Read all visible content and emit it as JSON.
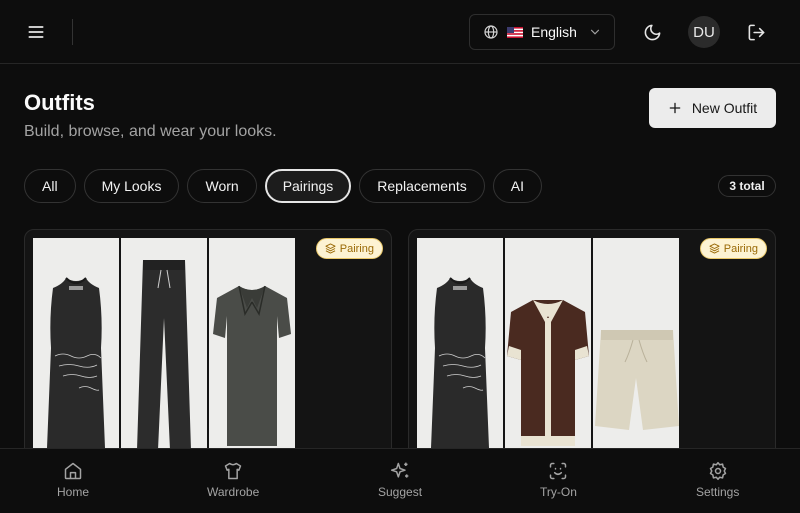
{
  "header": {
    "language": "English",
    "avatar_initials": "DU"
  },
  "page": {
    "title": "Outfits",
    "subtitle": "Build, browse, and wear your looks.",
    "new_button_label": "New Outfit"
  },
  "tabs": [
    {
      "label": "All",
      "active": false
    },
    {
      "label": "My Looks",
      "active": false
    },
    {
      "label": "Worn",
      "active": false
    },
    {
      "label": "Pairings",
      "active": true
    },
    {
      "label": "Replacements",
      "active": false
    },
    {
      "label": "AI",
      "active": false
    }
  ],
  "total_label": "3 total",
  "cards": [
    {
      "badge": "Pairing",
      "items": [
        "tank-top",
        "trousers",
        "polo-shirt"
      ]
    },
    {
      "badge": "Pairing",
      "items": [
        "tank-top",
        "camp-shirt",
        "shorts"
      ]
    }
  ],
  "bottom_nav": [
    {
      "label": "Home",
      "icon": "home-icon"
    },
    {
      "label": "Wardrobe",
      "icon": "shirt-icon"
    },
    {
      "label": "Suggest",
      "icon": "sparkles-icon"
    },
    {
      "label": "Try-On",
      "icon": "scan-face-icon"
    },
    {
      "label": "Settings",
      "icon": "gear-icon"
    }
  ],
  "colors": {
    "background": "#0d0d0d",
    "badge_bg": "#fdf3d3",
    "badge_text": "#9a6a07"
  }
}
